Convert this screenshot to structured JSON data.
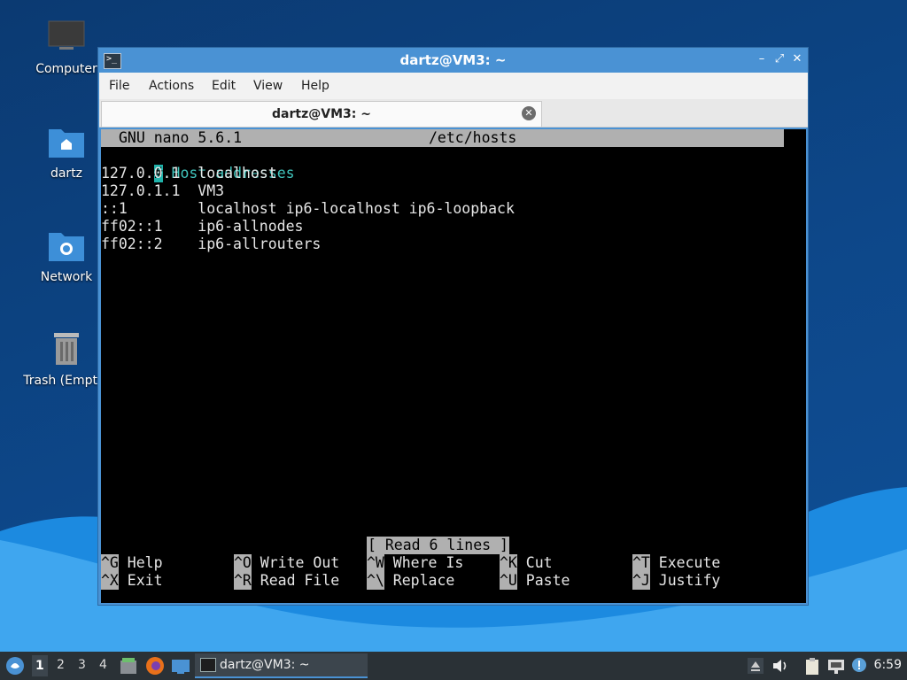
{
  "desktop": {
    "icons": [
      {
        "label": "Computer"
      },
      {
        "label": "dartz"
      },
      {
        "label": "Network"
      },
      {
        "label": "Trash (Empty)"
      }
    ]
  },
  "window": {
    "title": "dartz@VM3: ~",
    "app_icon_glyph": ">_",
    "buttons": {
      "minimize": "–",
      "maximize": "⤢",
      "close": "✕"
    },
    "menu": [
      "File",
      "Actions",
      "Edit",
      "View",
      "Help"
    ],
    "tab": {
      "title": "dartz@VM3: ~",
      "close_glyph": "✕"
    }
  },
  "nano": {
    "version": "GNU nano 5.6.1",
    "filename": "/etc/hosts",
    "cursor_char": "#",
    "comment": " Host addresses",
    "lines": [
      "127.0.0.1  localhost",
      "127.0.1.1  VM3",
      "::1        localhost ip6-localhost ip6-loopback",
      "ff02::1    ip6-allnodes",
      "ff02::2    ip6-allrouters"
    ],
    "status": "[ Read 6 lines ]",
    "shortcuts": [
      [
        {
          "key": "^G",
          "label": " Help"
        },
        {
          "key": "^O",
          "label": " Write Out"
        },
        {
          "key": "^W",
          "label": " Where Is"
        },
        {
          "key": "^K",
          "label": " Cut"
        },
        {
          "key": "^T",
          "label": " Execute"
        }
      ],
      [
        {
          "key": "^X",
          "label": " Exit"
        },
        {
          "key": "^R",
          "label": " Read File"
        },
        {
          "key": "^\\",
          "label": " Replace"
        },
        {
          "key": "^U",
          "label": " Paste"
        },
        {
          "key": "^J",
          "label": " Justify"
        }
      ]
    ]
  },
  "taskbar": {
    "workspaces": [
      "1",
      "2",
      "3",
      "4"
    ],
    "active_workspace": "1",
    "task": "dartz@VM3: ~",
    "clock": "6:59"
  }
}
